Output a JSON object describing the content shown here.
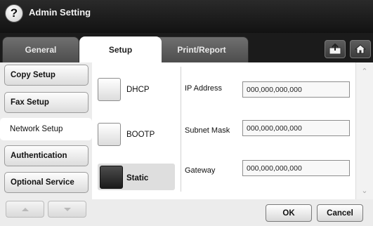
{
  "window": {
    "title": "Admin Setting",
    "help_glyph": "?"
  },
  "tabs": [
    {
      "label": "General",
      "selected": false
    },
    {
      "label": "Setup",
      "selected": true
    },
    {
      "label": "Print/Report",
      "selected": false
    }
  ],
  "header_icons": {
    "export": "export-icon",
    "home": "home-icon"
  },
  "sidebar": {
    "items": [
      {
        "label": "Copy Setup",
        "selected": false
      },
      {
        "label": "Fax Setup",
        "selected": false
      },
      {
        "label": "Network Setup",
        "selected": true
      },
      {
        "label": "Authentication",
        "selected": false
      },
      {
        "label": "Optional Service",
        "selected": false
      }
    ]
  },
  "ip_methods": [
    {
      "label": "DHCP",
      "selected": false
    },
    {
      "label": "BOOTP",
      "selected": false
    },
    {
      "label": "Static",
      "selected": true
    }
  ],
  "fields": {
    "ip": {
      "label": "IP Address",
      "value": "000,000,000,000"
    },
    "mask": {
      "label": "Subnet Mask",
      "value": "000,000,000,000"
    },
    "gateway": {
      "label": "Gateway",
      "value": "000,000,000,000"
    }
  },
  "buttons": {
    "ok": "OK",
    "cancel": "Cancel"
  },
  "colors": {
    "titlebar": "#1a1a1a",
    "selected_radio": "#2a2a2a"
  }
}
